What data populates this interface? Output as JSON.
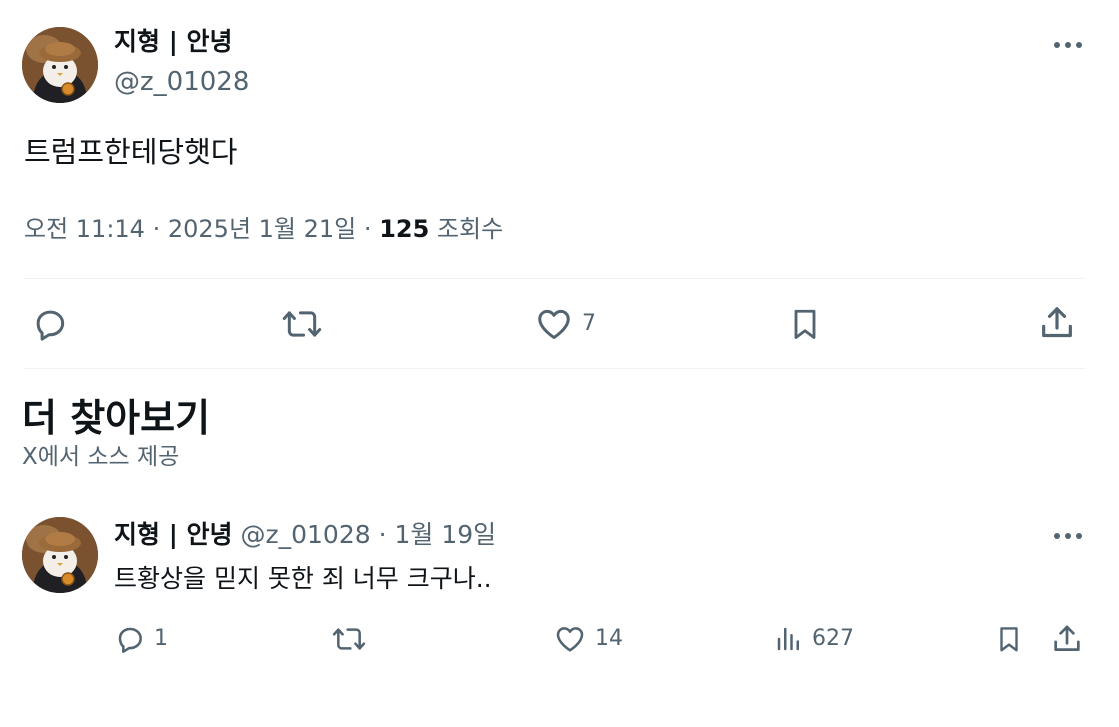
{
  "main_tweet": {
    "display_name": "지형 | 안녕",
    "handle": "@z_01028",
    "text": "트럼프한테당햇다",
    "time": "오전 11:14",
    "date": "2025년 1월 21일",
    "separator": "·",
    "views_count": "125",
    "views_label": "조회수",
    "likes_count": "7",
    "icons": {
      "more": "more-horizontal-icon",
      "reply": "reply-icon",
      "retweet": "retweet-icon",
      "like": "heart-icon",
      "bookmark": "bookmark-icon",
      "share": "share-icon"
    }
  },
  "more_section": {
    "title": "더 찾아보기",
    "subtitle": "X에서 소스 제공"
  },
  "related_tweet": {
    "display_name": "지형 | 안녕",
    "handle": "@z_01028",
    "separator": "·",
    "date": "1월 19일",
    "text": "트황상을 믿지 못한 죄 너무 크구나..",
    "replies_count": "1",
    "likes_count": "14",
    "views_count": "627",
    "icons": {
      "more": "more-horizontal-icon",
      "reply": "reply-icon",
      "retweet": "retweet-icon",
      "like": "heart-icon",
      "views": "analytics-icon",
      "bookmark": "bookmark-icon",
      "share": "share-icon"
    }
  },
  "colors": {
    "text_primary": "#0f1419",
    "text_secondary": "#536471",
    "divider": "#eff3f4",
    "background": "#ffffff"
  }
}
